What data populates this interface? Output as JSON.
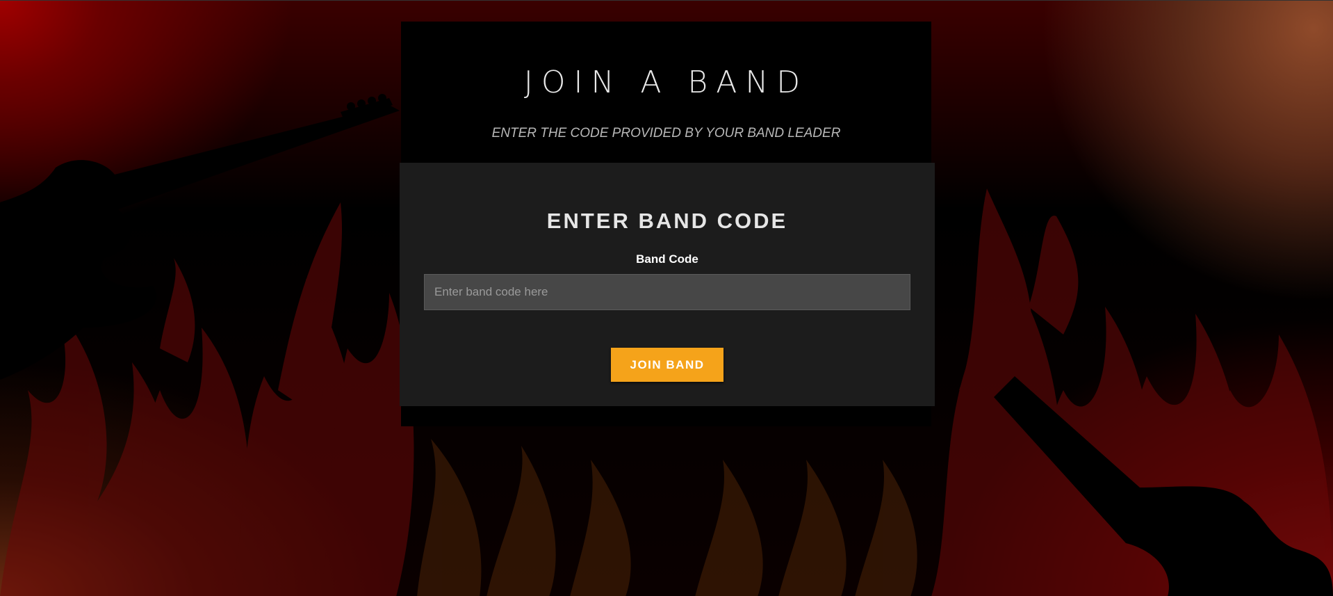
{
  "page": {
    "title": "JOIN A BAND",
    "subtitle": "ENTER THE CODE PROVIDED BY YOUR BAND LEADER"
  },
  "form": {
    "heading": "ENTER BAND CODE",
    "field_label": "Band Code",
    "input_value": "",
    "input_placeholder": "Enter band code here",
    "submit_label": "JOIN BAND"
  },
  "background": {
    "theme": "flames-and-guitars",
    "icons": [
      "guitar-silhouette-icon",
      "flames-icon"
    ]
  },
  "colors": {
    "accent": "#f5a31a",
    "card": "#1c1c1c",
    "panel": "#000000",
    "input": "#474747",
    "flame": "#7a0a0a"
  }
}
